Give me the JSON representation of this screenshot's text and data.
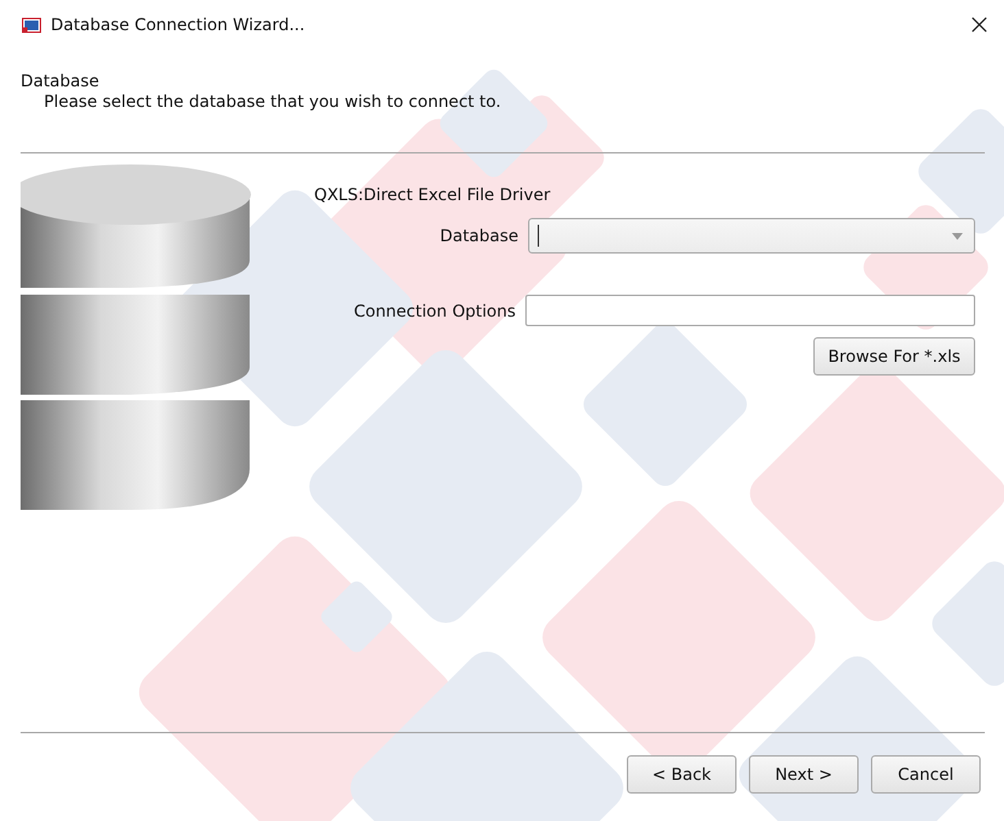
{
  "window": {
    "title": "Database Connection Wizard..."
  },
  "header": {
    "title": "Database",
    "subtitle": "Please select the database that you wish to connect to."
  },
  "driver": "QXLS:Direct Excel File Driver",
  "fields": [
    {
      "kind": "combo",
      "label": "Database"
    },
    {
      "kind": "text",
      "label": "Connection Options"
    }
  ],
  "browse_button": "Browse For *.xls",
  "buttons": [
    "< Back",
    "Next >",
    "Cancel"
  ]
}
